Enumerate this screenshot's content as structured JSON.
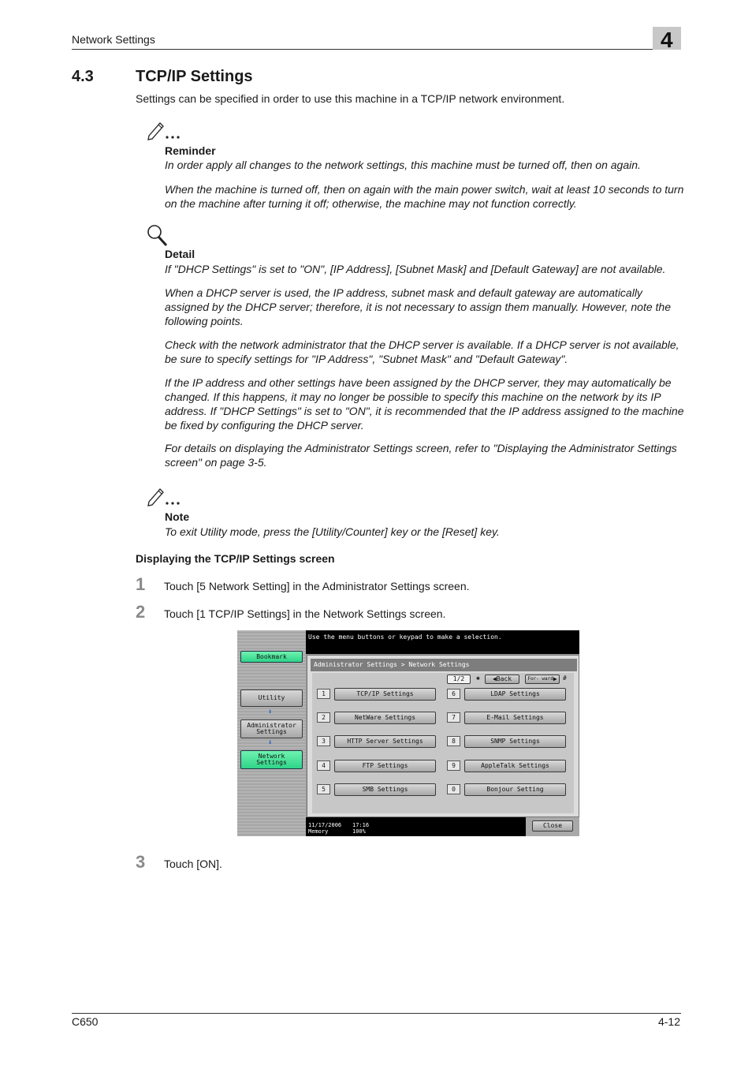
{
  "header": {
    "section": "Network Settings",
    "chapter": "4"
  },
  "section": {
    "number": "4.3",
    "title": "TCP/IP Settings",
    "intro": "Settings can be specified in order to use this machine in a TCP/IP network environment."
  },
  "reminder": {
    "label": "Reminder",
    "p1": "In order apply all changes to the network settings, this machine must be turned off, then on again.",
    "p2": "When the machine is turned off, then on again with the main power switch, wait at least 10 seconds to turn on the machine after turning it off; otherwise, the machine may not function correctly."
  },
  "detail": {
    "label": "Detail",
    "p1": "If \"DHCP Settings\" is set to \"ON\", [IP Address], [Subnet Mask] and [Default Gateway] are not available.",
    "p2": "When a DHCP server is used, the IP address, subnet mask and default gateway are automatically assigned by the DHCP server; therefore, it is not necessary to assign them manually. However, note the following points.",
    "p3": "Check with the network administrator that the DHCP server is available. If a DHCP server is not available, be sure to specify settings for \"IP Address\", \"Subnet Mask\" and \"Default Gateway\".",
    "p4": "If the IP address and other settings have been assigned by the DHCP server, they may automatically be changed. If this happens, it may no longer be possible to specify this machine on the network by its IP address. If \"DHCP Settings\" is set to \"ON\", it is recommended that the IP address assigned to the machine be fixed by configuring the DHCP server.",
    "p5": "For details on displaying the Administrator Settings screen, refer to \"Displaying the Administrator Settings screen\" on page 3-5."
  },
  "note": {
    "label": "Note",
    "p1": "To exit Utility mode, press the [Utility/Counter] key or the [Reset] key."
  },
  "procedure": {
    "heading": "Displaying the TCP/IP Settings screen",
    "steps": [
      {
        "num": "1",
        "text": "Touch [5 Network Setting] in the Administrator Settings screen."
      },
      {
        "num": "2",
        "text": "Touch [1 TCP/IP Settings] in the Network Settings screen."
      },
      {
        "num": "3",
        "text": "Touch [ON]."
      }
    ]
  },
  "screen": {
    "message": "Use the menu buttons or keypad to make a selection.",
    "breadcrumb": "Administrator Settings > Network Settings",
    "page": "1/2",
    "back": "Back",
    "forward": "For- ward",
    "left": {
      "bookmark": "Bookmark",
      "utility": "Utility",
      "admin": "Administrator Settings",
      "network": "Network Settings"
    },
    "buttons": [
      {
        "num": "1",
        "label": "TCP/IP Settings"
      },
      {
        "num": "2",
        "label": "NetWare Settings"
      },
      {
        "num": "3",
        "label": "HTTP Server Settings"
      },
      {
        "num": "4",
        "label": "FTP Settings"
      },
      {
        "num": "5",
        "label": "SMB Settings"
      },
      {
        "num": "6",
        "label": "LDAP Settings"
      },
      {
        "num": "7",
        "label": "E-Mail Settings"
      },
      {
        "num": "8",
        "label": "SNMP Settings"
      },
      {
        "num": "9",
        "label": "AppleTalk Settings"
      },
      {
        "num": "0",
        "label": "Bonjour Setting"
      }
    ],
    "date": "11/17/2006",
    "time": "17:16",
    "memory_label": "Memory",
    "memory_value": "100%",
    "close": "Close"
  },
  "footer": {
    "model": "C650",
    "page": "4-12"
  }
}
